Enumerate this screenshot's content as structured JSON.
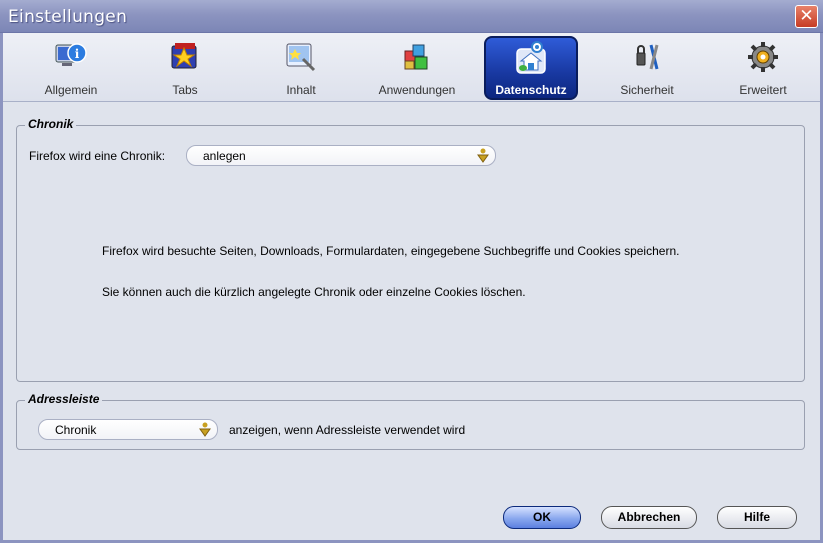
{
  "window": {
    "title": "Einstellungen",
    "close_label": "✕"
  },
  "tabs": [
    {
      "label": "Allgemein",
      "icon": "info-icon"
    },
    {
      "label": "Tabs",
      "icon": "tabs-icon"
    },
    {
      "label": "Inhalt",
      "icon": "content-icon"
    },
    {
      "label": "Anwendungen",
      "icon": "applications-icon"
    },
    {
      "label": "Datenschutz",
      "icon": "privacy-icon",
      "active": true
    },
    {
      "label": "Sicherheit",
      "icon": "security-icon"
    },
    {
      "label": "Erweitert",
      "icon": "advanced-icon"
    }
  ],
  "history": {
    "group_title": "Chronik",
    "label": "Firefox wird eine Chronik:",
    "selected": "anlegen",
    "info1": "Firefox wird besuchte Seiten, Downloads, Formulardaten, eingegebene Suchbegriffe und Cookies speichern.",
    "info2": "Sie können auch die kürzlich angelegte Chronik oder einzelne Cookies löschen."
  },
  "addressbar": {
    "group_title": "Adressleiste",
    "selected": "Chronik",
    "suffix": "anzeigen, wenn Adressleiste verwendet wird"
  },
  "buttons": {
    "ok": "OK",
    "cancel": "Abbrechen",
    "help": "Hilfe"
  }
}
